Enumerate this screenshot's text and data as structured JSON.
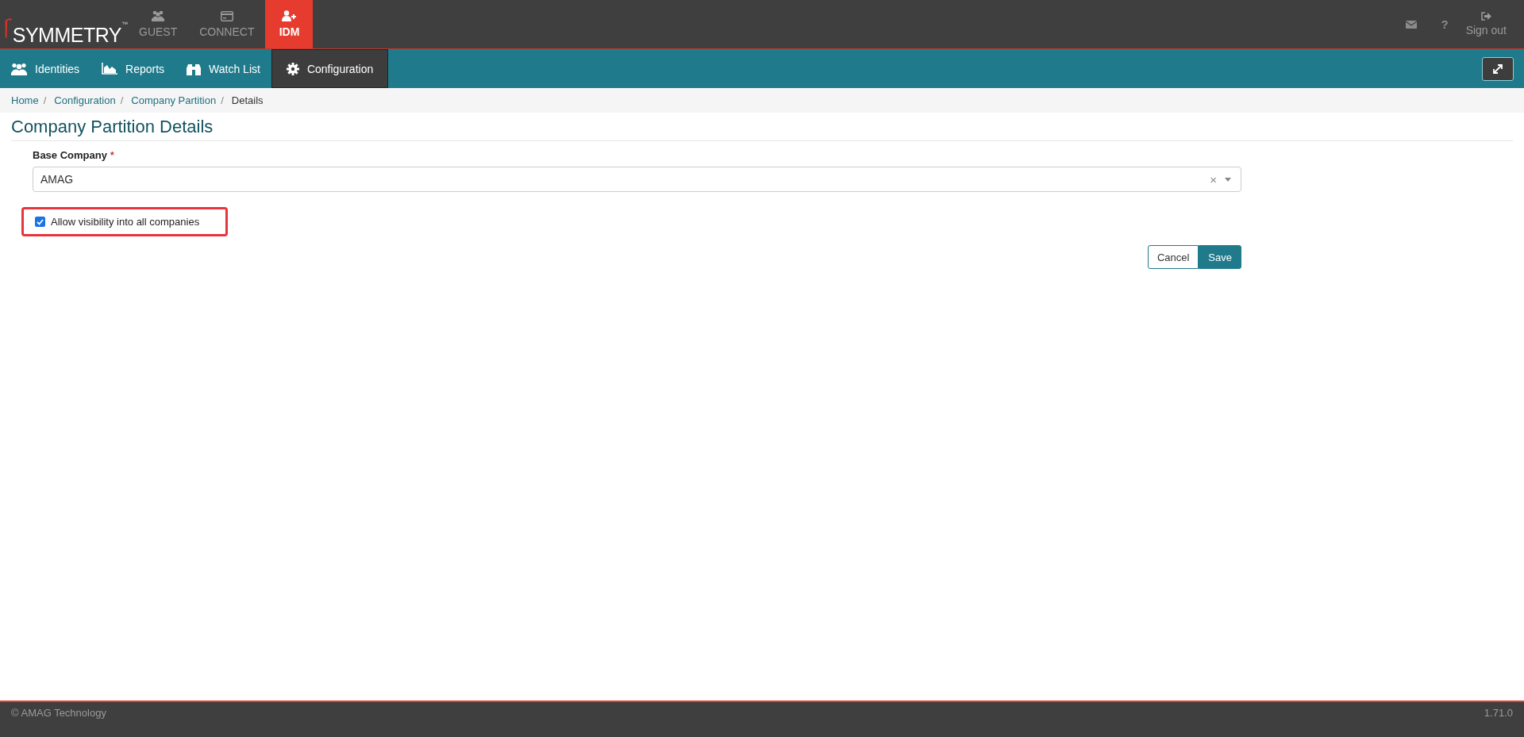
{
  "header": {
    "logo": {
      "name": "SYMMETRY",
      "mark": "™"
    },
    "apps": [
      {
        "label": "GUEST",
        "selected": false
      },
      {
        "label": "CONNECT",
        "selected": false
      },
      {
        "label": "IDM",
        "selected": true
      }
    ],
    "sign_out": "Sign out",
    "help": "?"
  },
  "nav": {
    "items": [
      {
        "label": "Identities",
        "selected": false
      },
      {
        "label": "Reports",
        "selected": false
      },
      {
        "label": "Watch List",
        "selected": false
      },
      {
        "label": "Configuration",
        "selected": true
      }
    ]
  },
  "breadcrumb": [
    {
      "label": "Home",
      "current": false
    },
    {
      "label": "Configuration",
      "current": false
    },
    {
      "label": "Company Partition",
      "current": false
    },
    {
      "label": "Details",
      "current": true
    }
  ],
  "breadcrumb_separator": "/",
  "page_title": "Company Partition Details",
  "form": {
    "base_company": {
      "label": "Base Company",
      "required": true,
      "required_mark": "*",
      "value": "AMAG",
      "clear": "×"
    },
    "visibility": {
      "label": "Allow visibility into all companies",
      "checked": true,
      "highlighted": true
    },
    "buttons": [
      {
        "label": "Cancel",
        "kind": "secondary"
      },
      {
        "label": "Save",
        "kind": "primary"
      }
    ]
  },
  "footer": {
    "copyright": "© AMAG Technology",
    "version": "1.71.0"
  }
}
